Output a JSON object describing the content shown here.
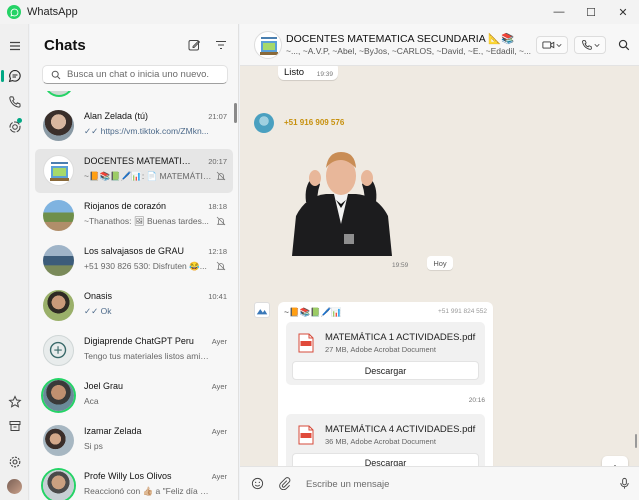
{
  "window": {
    "title": "WhatsApp",
    "controls": [
      "—",
      "☐",
      "✕"
    ]
  },
  "chat_list": {
    "title": "Chats",
    "search_placeholder": "Busca un chat o inicia uno nuevo.",
    "chats": [
      {
        "name": "Alan Zelada (tú)",
        "time": "21:07",
        "preview": "✓✓ https://vm.tiktok.com/ZMkn...",
        "muted": false
      },
      {
        "name": "DOCENTES MATEMATICA...",
        "time": "20:17",
        "preview": "~📙📚📗🖊️📊: 📄 MATEMÁTIC...",
        "muted": true
      },
      {
        "name": "Riojanos de corazón",
        "time": "18:18",
        "preview": "~Thanathos: 🖼 Buenas tardes...",
        "muted": true
      },
      {
        "name": "Los salvajasos de GRAU",
        "time": "12:18",
        "preview": "+51 930 826 530: Disfruten 😂...",
        "muted": true
      },
      {
        "name": "Onasis",
        "time": "10:41",
        "preview": "✓✓ Ok",
        "muted": false
      },
      {
        "name": "Digiaprende ChatGPT Peru",
        "time": "Ayer",
        "preview": "Tengo tus materiales listos amig...",
        "muted": false
      },
      {
        "name": "Joel Grau",
        "time": "Ayer",
        "preview": "Aca",
        "muted": false
      },
      {
        "name": "Izamar Zelada",
        "time": "Ayer",
        "preview": "Si ps",
        "muted": false
      },
      {
        "name": "Profe Willy Los Olivos",
        "time": "Ayer",
        "preview": "Reaccionó con 👍🏼 a \"Feliz día mi...",
        "muted": false
      }
    ]
  },
  "conversation": {
    "group_name": "DOCENTES MATEMATICA SECUNDARIA 📐📚",
    "members": "~..., ~A.V.P, ~Abel, ~ByJos, ~CARLOS, ~David, ~E., ~Edadil, ~...",
    "messages": {
      "listo_text": "Listo",
      "listo_time": "19:39",
      "sender_phone": "+51 916 909 576",
      "sticker_time": "19:59",
      "day_separator": "Hoy",
      "doc_sender": "~📙📚📗🖊️📊",
      "doc_sender_phone": "+51 991 824 552",
      "doc1_name": "MATEMÁTICA 1 ACTIVIDADES.pdf",
      "doc1_meta": "27 MB, Adobe Acrobat Document",
      "doc1_time": "20:16",
      "doc2_name": "MATEMÁTICA 4 ACTIVIDADES.pdf",
      "doc2_meta": "36 MB, Adobe Acrobat Document",
      "download_label": "Descargar",
      "pdf_label": "PDF"
    },
    "composer_placeholder": "Escribe un mensaje"
  },
  "colors": {
    "accent": "#00a884",
    "ring": "#25d366",
    "chat_bg": "#efeae2",
    "phone_color": "#c7900c",
    "pdf_red": "#e04a3b"
  }
}
